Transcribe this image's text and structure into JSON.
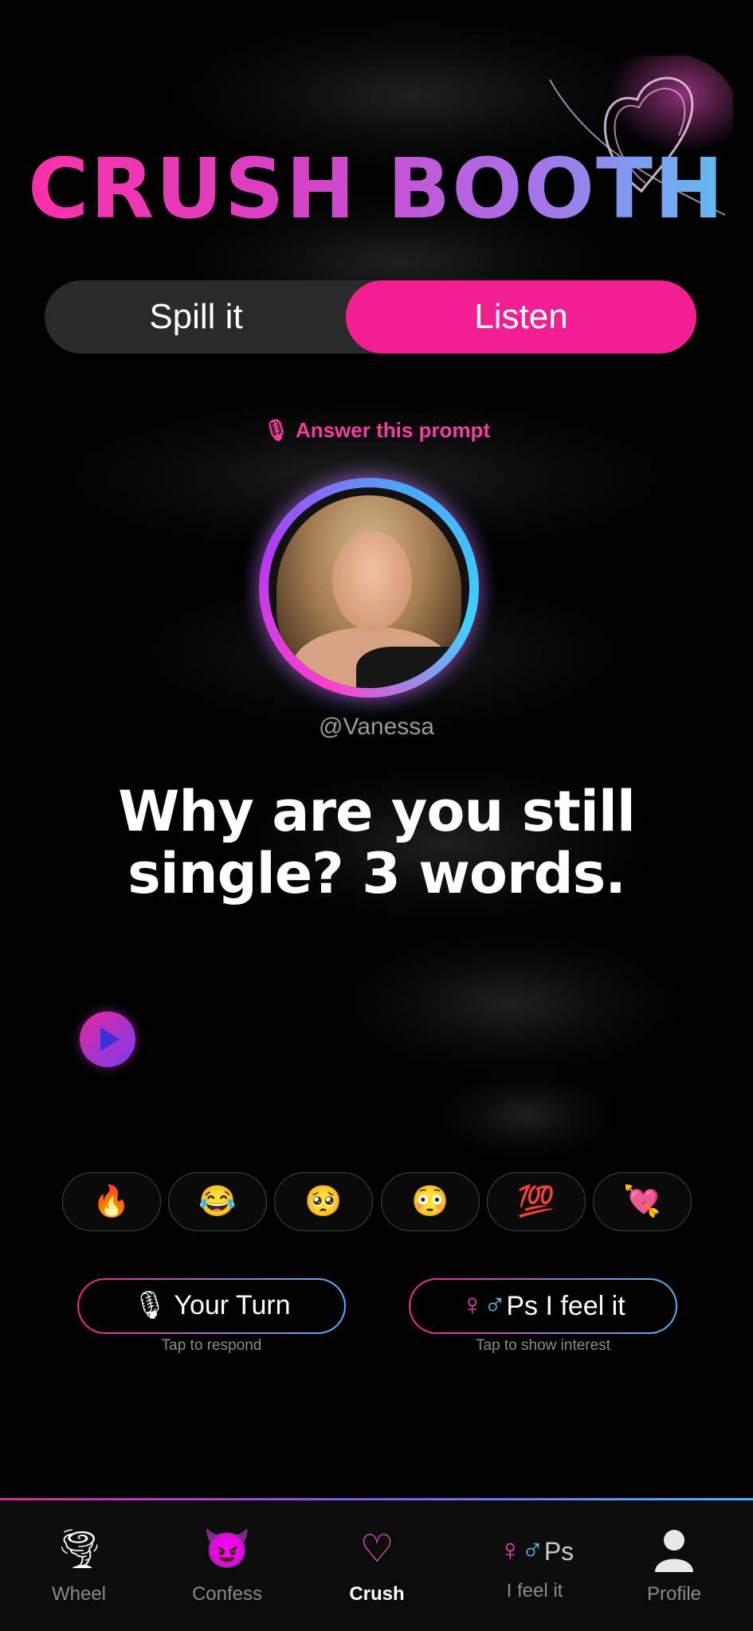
{
  "app": {
    "title": "CRUSH BOOTH"
  },
  "mode_toggle": {
    "left_label": "Spill it",
    "right_label": "Listen",
    "selected": "Listen"
  },
  "prompt": {
    "label": "Answer this prompt",
    "icon": "microphone-icon",
    "username": "@Vanessa",
    "question": "Why are you still single? 3 words."
  },
  "audio": {
    "play_icon": "play-icon"
  },
  "reactions": [
    {
      "emoji": "🔥",
      "name": "fire"
    },
    {
      "emoji": "😂",
      "name": "laughing"
    },
    {
      "emoji": "🥺",
      "name": "pleading"
    },
    {
      "emoji": "😳",
      "name": "flushed"
    },
    {
      "emoji": "💯",
      "name": "hundred"
    },
    {
      "emoji": "💘",
      "name": "heart-arrow"
    }
  ],
  "actions": {
    "your_turn_label": "Your Turn",
    "your_turn_caption": "Tap to respond",
    "feel_it_label": "I feel it",
    "feel_it_prefix": "Ps",
    "feel_it_caption": "Tap to show interest"
  },
  "colors": {
    "accent_pink": "#f21f93",
    "accent_blue": "#54b4ff",
    "background": "#000000"
  },
  "nav": {
    "items": [
      {
        "label": "Wheel",
        "icon": "tornado-icon"
      },
      {
        "label": "Confess",
        "icon": "devil-face-icon"
      },
      {
        "label": "Crush",
        "icon": "heart-scribble-icon",
        "active": true
      },
      {
        "label": "I feel it",
        "icon": "gender-symbols-icon",
        "prefix": "Ps"
      },
      {
        "label": "Profile",
        "icon": "person-icon"
      }
    ]
  }
}
